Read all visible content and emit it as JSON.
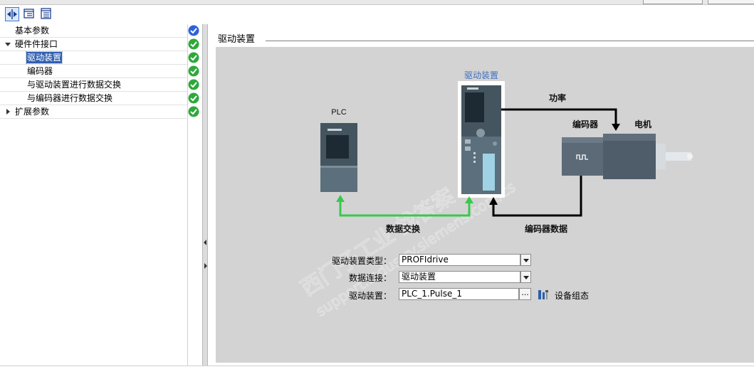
{
  "tree": {
    "items": [
      {
        "label": "基本参数",
        "expander": "none",
        "indent": 0,
        "selected": false,
        "status": "info"
      },
      {
        "label": "硬件件接口",
        "expander": "expanded",
        "indent": 0,
        "selected": false,
        "status": "ok"
      },
      {
        "label": "驱动装置",
        "expander": "none",
        "indent": 1,
        "selected": true,
        "status": "ok"
      },
      {
        "label": "编码器",
        "expander": "none",
        "indent": 1,
        "selected": false,
        "status": "ok"
      },
      {
        "label": "与驱动装置进行数据交换",
        "expander": "none",
        "indent": 1,
        "selected": false,
        "status": "ok"
      },
      {
        "label": "与编码器进行数据交换",
        "expander": "none",
        "indent": 1,
        "selected": false,
        "status": "ok"
      },
      {
        "label": "扩展参数",
        "expander": "collapsed",
        "indent": 0,
        "selected": false,
        "status": "ok"
      }
    ]
  },
  "section": {
    "title": "驱动装置"
  },
  "diagram": {
    "plc_label": "PLC",
    "drive_label": "驱动装置",
    "power_label": "功率",
    "encoder_label": "编码器",
    "motor_label": "电机",
    "data_exchange_label": "数据交换",
    "encoder_data_label": "编码器数据"
  },
  "form": {
    "drive_type": {
      "label": "驱动装置类型：",
      "value": "PROFIdrive"
    },
    "data_connection": {
      "label": "数据连接：",
      "value": "驱动装置"
    },
    "drive": {
      "label": "驱动装置：",
      "value": "PLC_1.Pulse_1",
      "browse": "..."
    },
    "device_config_label": "设备组态"
  },
  "watermark": {
    "line1": "西门子工业  找答案",
    "line2": "support.industry.siemens.com/cs"
  },
  "colors": {
    "selection": "#2f5fb0",
    "canvas": "#d3d3d3",
    "ok_status": "#2ea83a",
    "info_status": "#2f62d8",
    "drive_title": "#3f6fc0",
    "data_link": "#38c84c"
  }
}
